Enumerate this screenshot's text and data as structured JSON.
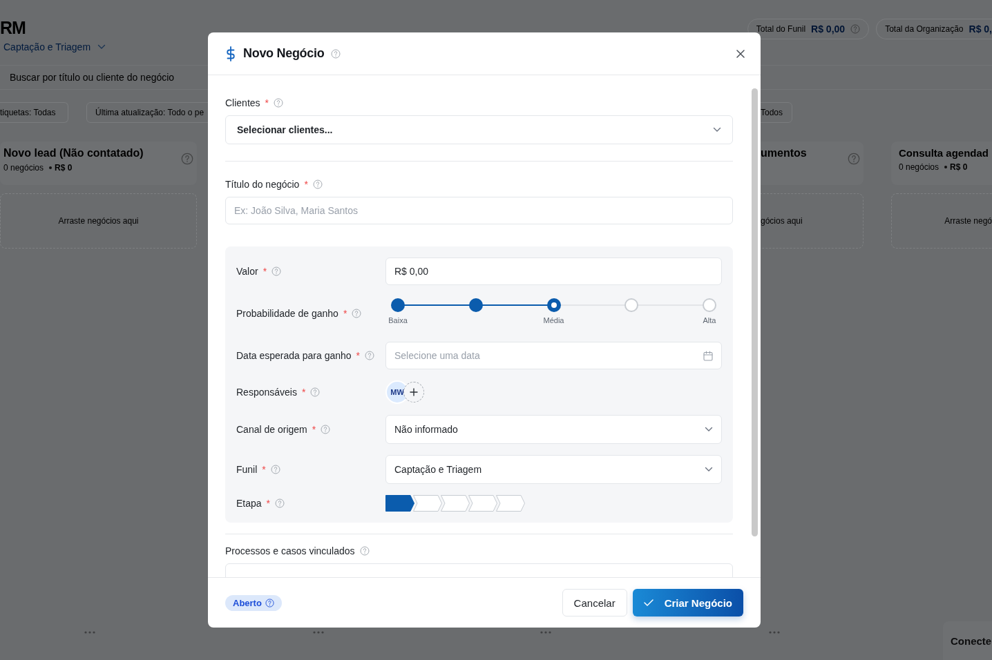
{
  "backdrop": {
    "app_title": "RM",
    "funnel": "Captação e Triagem",
    "totals": [
      {
        "label": "Total do Funil",
        "value": "R$ 0,00",
        "help": true
      },
      {
        "label": "Total da Organização",
        "value": "R$ 0,",
        "help": false
      }
    ],
    "search": {
      "placeholder": "Buscar por título ou cliente do negócio"
    },
    "filters": [
      "tiquetas: Todas",
      "Última atualização: Todo o pe",
      "Todos"
    ],
    "columns": [
      {
        "title": "Novo lead (Não contatado)",
        "count": "0 negócios",
        "total": "R$ 0",
        "dropzone": "Arraste negócios aqui"
      },
      {
        "title": "umentos",
        "dropzone": "gócios aqui"
      },
      {
        "title": "Consulta agendad",
        "count": "0 negócios",
        "total": "R$ 0",
        "dropzone": "Arraste negó"
      }
    ],
    "bottom_card": "Conecte"
  },
  "dialog": {
    "title": "Novo Negócio",
    "required_mark": "*",
    "clients": {
      "label": "Clientes",
      "required": true,
      "value": "Selecionar clientes..."
    },
    "deal_title": {
      "label": "Título do negócio",
      "required": true,
      "placeholder": "Ex: João Silva, Maria Santos"
    },
    "details": [
      {
        "kind": "input",
        "label": "Valor",
        "required": true,
        "value": "R$ 0,00"
      },
      {
        "kind": "probability",
        "label": "Probabilidade de ganho",
        "required": true,
        "level": 0.5,
        "scale": [
          "Baixa",
          "Média",
          "Alta"
        ]
      },
      {
        "kind": "date",
        "label": "Data esperada para ganho",
        "required": true,
        "placeholder": "Selecione uma data"
      },
      {
        "kind": "people",
        "label": "Responsáveis",
        "required": true,
        "avatars": [
          "MW"
        ]
      },
      {
        "kind": "select",
        "label": "Canal de origem",
        "required": true,
        "value": "Não informado"
      },
      {
        "kind": "select",
        "label": "Funil",
        "required": true,
        "value": "Captação e Triagem"
      },
      {
        "kind": "stages",
        "label": "Etapa",
        "required": true,
        "stages": [
          {
            "selected": true
          },
          {
            "selected": false
          },
          {
            "selected": false
          },
          {
            "selected": false
          },
          {
            "selected": false
          }
        ]
      }
    ],
    "linked": {
      "label": "Processos e casos vinculados",
      "required": false
    },
    "status": "Aberto",
    "cancel": "Cancelar",
    "submit": "Criar Negócio"
  }
}
